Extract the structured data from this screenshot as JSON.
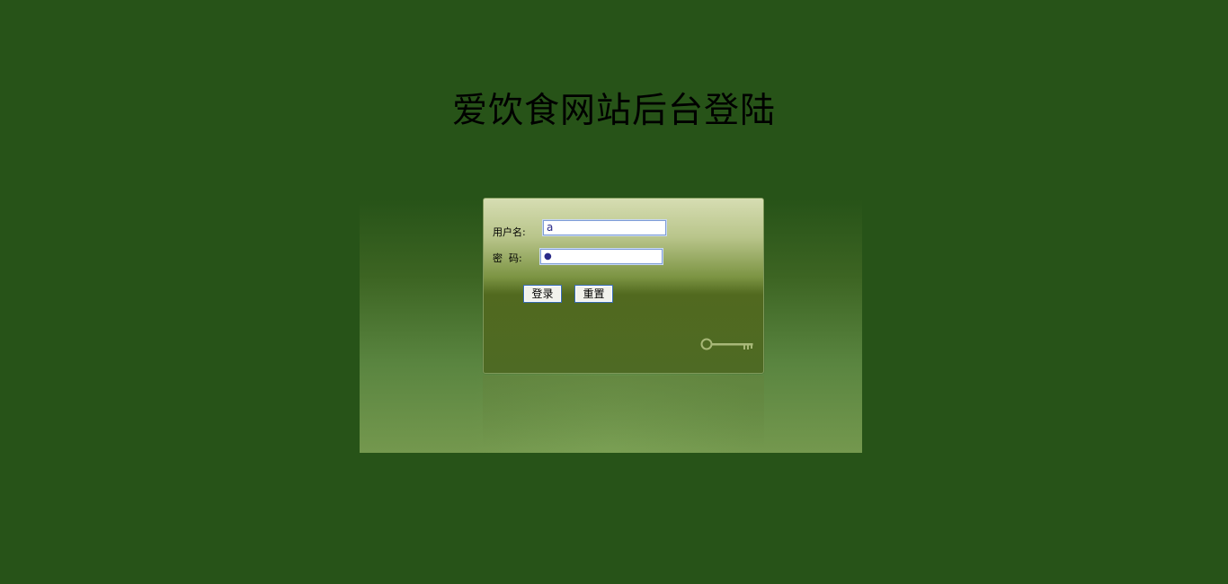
{
  "header": {
    "title": "爱饮食网站后台登陆"
  },
  "login": {
    "username_label": "用户名:",
    "username_value": "a",
    "password_label": "密  码:",
    "password_value": "●",
    "login_button": "登录",
    "reset_button": "重置"
  },
  "icons": {
    "key": "key-icon"
  },
  "colors": {
    "background": "#275318",
    "panel_top": "#d6ddb2",
    "panel_bottom": "#4e6a24"
  }
}
